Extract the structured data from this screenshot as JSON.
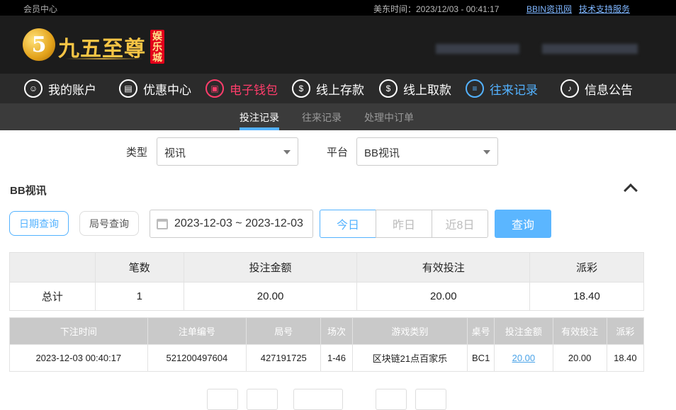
{
  "topbar": {
    "member_center": "会员中心",
    "time": "美东时间：2023/12/03 - 00:41:17",
    "link1": "BBIN资讯网",
    "link2": "技术支持服务"
  },
  "logo": {
    "mark": "5",
    "name": "九五至尊",
    "badge": "娱乐城"
  },
  "nav": [
    {
      "label": "我的账户",
      "icon": "user-icon",
      "glyph": "☺"
    },
    {
      "label": "优惠中心",
      "icon": "gift-icon",
      "glyph": "▤"
    },
    {
      "label": "电子钱包",
      "icon": "wallet-icon",
      "glyph": "▣"
    },
    {
      "label": "线上存款",
      "icon": "deposit-icon",
      "glyph": "$"
    },
    {
      "label": "线上取款",
      "icon": "withdraw-icon",
      "glyph": "$"
    },
    {
      "label": "往来记录",
      "icon": "records-icon",
      "glyph": "≡"
    },
    {
      "label": "信息公告",
      "icon": "bell-icon",
      "glyph": "♪"
    }
  ],
  "subnav": [
    "投注记录",
    "往来记录",
    "处理中订单"
  ],
  "filters": {
    "type_label": "类型",
    "type_value": "视讯",
    "platform_label": "平台",
    "platform_value": "BB视讯"
  },
  "section_title": "BB视讯",
  "query": {
    "date_tab": "日期查询",
    "round_tab": "局号查询",
    "date_range": "2023-12-03 ~ 2023-12-03",
    "today": "今日",
    "yesterday": "昨日",
    "last8": "近8日",
    "submit": "查询"
  },
  "summary": {
    "headers": [
      "",
      "笔数",
      "投注金额",
      "有效投注",
      "派彩"
    ],
    "row": [
      "总计",
      "1",
      "20.00",
      "20.00",
      "18.40"
    ]
  },
  "detail": {
    "headers": [
      "下注时间",
      "注单编号",
      "局号",
      "场次",
      "游戏类别",
      "桌号",
      "投注金额",
      "有效投注",
      "派彩"
    ],
    "rows": [
      [
        "2023-12-03 00:40:17",
        "521200497604",
        "427191725",
        "1-46",
        "区块链21点百家乐",
        "BC1",
        "20.00",
        "20.00",
        "18.40"
      ]
    ]
  },
  "colors": {
    "accent_blue": "#53b2ff",
    "accent_red": "#ff3d6b",
    "nav_bg": "#2b2b2b"
  }
}
